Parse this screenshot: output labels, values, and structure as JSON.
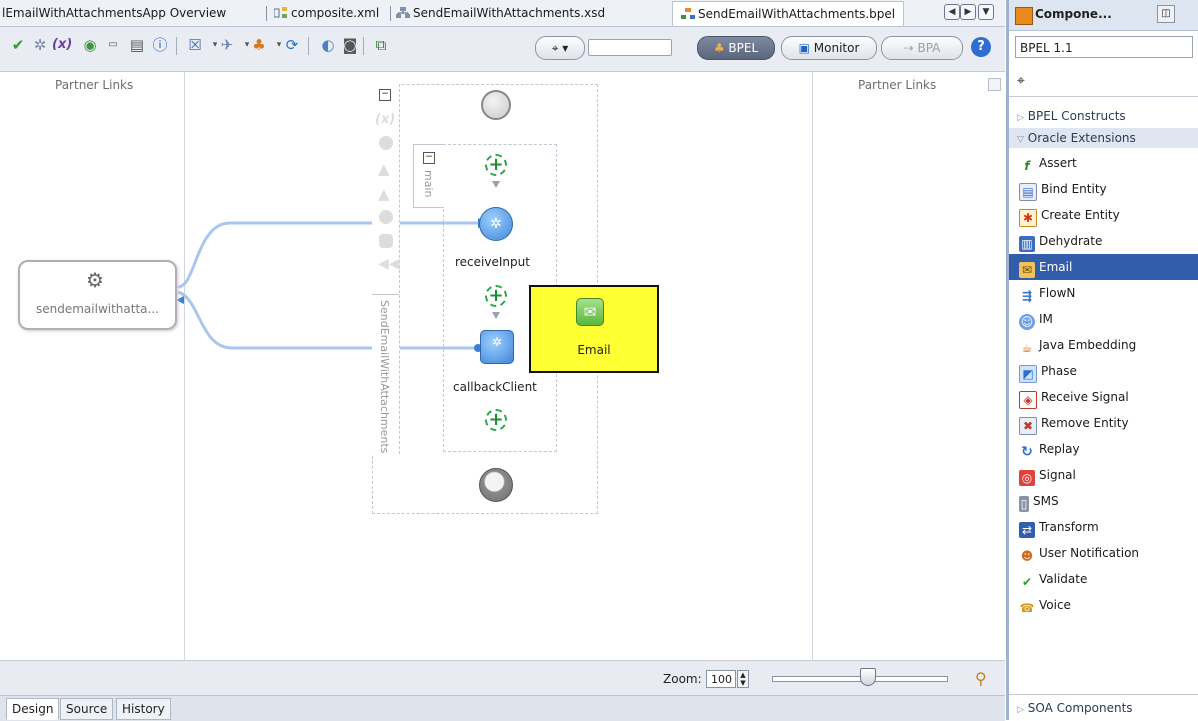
{
  "tabs": [
    {
      "label": "lEmailWithAttachmentsApp Overview"
    },
    {
      "label": "composite.xml"
    },
    {
      "label": "SendEmailWithAttachments.xsd"
    },
    {
      "label": "SendEmailWithAttachments.bpel"
    }
  ],
  "toolbar": {
    "bpel_label": "BPEL",
    "monitor_label": "Monitor",
    "bpa_label": "BPA",
    "search_value": ""
  },
  "canvas": {
    "partner_links_left": "Partner Links",
    "partner_links_right": "Partner Links",
    "partner_link_name": "sendemailwithatta...",
    "process_name": "SendEmailWithAttachments",
    "sequence_name": "main",
    "activities": [
      {
        "label": "receiveInput"
      },
      {
        "label": "callbackClient"
      }
    ],
    "tooltip_label": "Email"
  },
  "zoom": {
    "label": "Zoom:",
    "value": "100",
    "slider_level_percent": 55
  },
  "bottom_tabs": [
    {
      "label": "Design"
    },
    {
      "label": "Source"
    },
    {
      "label": "History"
    }
  ],
  "components": {
    "title": "Compone...",
    "palette": "BPEL 1.1",
    "section_bpel": "BPEL Constructs",
    "section_oracle": "Oracle Extensions",
    "section_soa": "SOA Components",
    "items": [
      {
        "label": "Assert",
        "icon": "assert-icon"
      },
      {
        "label": "Bind Entity",
        "icon": "bind-entity-icon"
      },
      {
        "label": "Create Entity",
        "icon": "create-entity-icon"
      },
      {
        "label": "Dehydrate",
        "icon": "dehydrate-icon"
      },
      {
        "label": "Email",
        "icon": "email-icon"
      },
      {
        "label": "FlowN",
        "icon": "flown-icon"
      },
      {
        "label": "IM",
        "icon": "im-icon"
      },
      {
        "label": "Java Embedding",
        "icon": "java-icon"
      },
      {
        "label": "Phase",
        "icon": "phase-icon"
      },
      {
        "label": "Receive Signal",
        "icon": "receive-signal-icon"
      },
      {
        "label": "Remove Entity",
        "icon": "remove-entity-icon"
      },
      {
        "label": "Replay",
        "icon": "replay-icon"
      },
      {
        "label": "Signal",
        "icon": "signal-icon"
      },
      {
        "label": "SMS",
        "icon": "sms-icon"
      },
      {
        "label": "Transform",
        "icon": "transform-icon"
      },
      {
        "label": "User Notification",
        "icon": "user-notification-icon"
      },
      {
        "label": "Validate",
        "icon": "validate-icon"
      },
      {
        "label": "Voice",
        "icon": "voice-icon"
      }
    ],
    "selected_index": 4
  },
  "colors": {
    "selection": "#315dab",
    "tooltip": "#ffff33",
    "link": "#a9c7ee"
  }
}
